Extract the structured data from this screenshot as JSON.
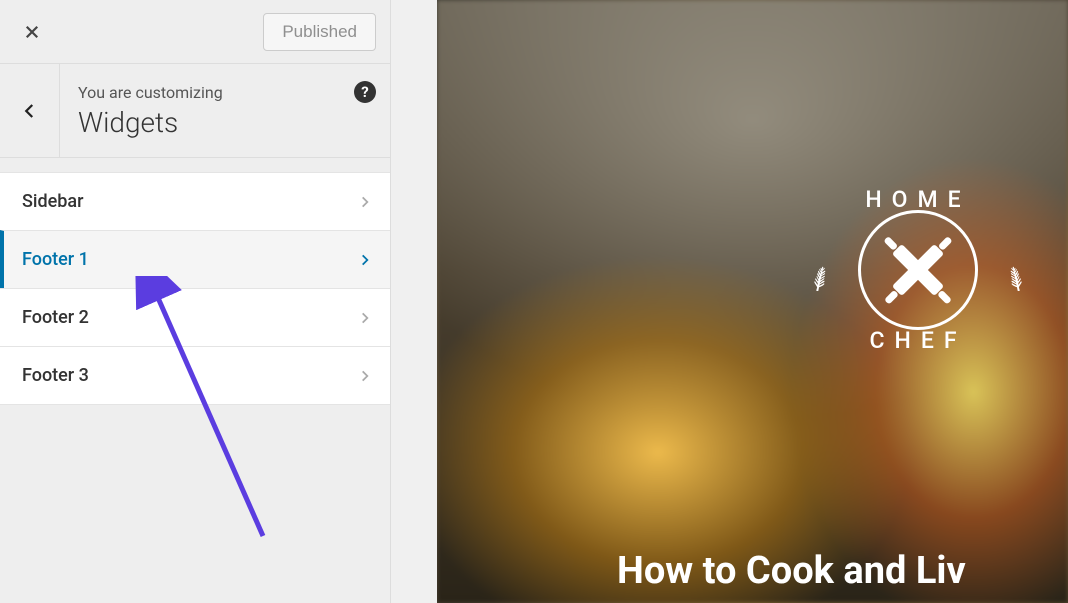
{
  "topBar": {
    "publishLabel": "Published"
  },
  "header": {
    "customizingLabel": "You are customizing",
    "sectionTitle": "Widgets"
  },
  "widgets": [
    {
      "label": "Sidebar",
      "active": false
    },
    {
      "label": "Footer 1",
      "active": true
    },
    {
      "label": "Footer 2",
      "active": false
    },
    {
      "label": "Footer 3",
      "active": false
    }
  ],
  "preview": {
    "logoTop": "HOME",
    "logoBottom": "CHEF",
    "heading": "How to Cook and Liv"
  },
  "colors": {
    "accent": "#0073aa",
    "annotation": "#5b3de0"
  }
}
